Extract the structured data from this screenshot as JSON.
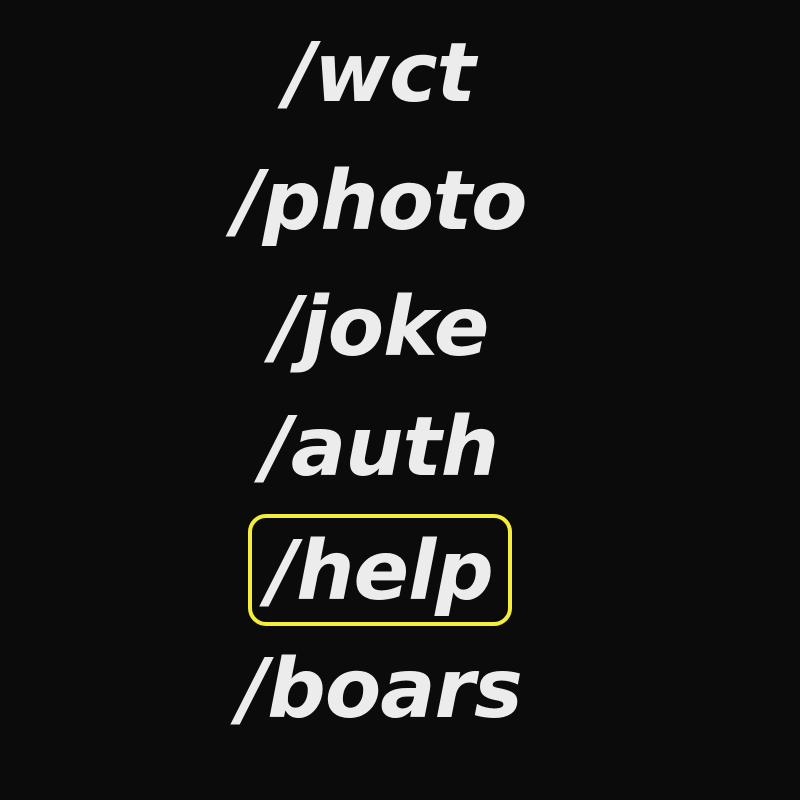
{
  "commands": [
    {
      "label": "/wct"
    },
    {
      "label": "/photo"
    },
    {
      "label": "/joke"
    },
    {
      "label": "/auth"
    },
    {
      "label": "/help"
    },
    {
      "label": "/boars"
    }
  ],
  "selected_index": 4,
  "colors": {
    "background": "#0b0b0b",
    "text": "#ececec",
    "highlight": "#f4ee3a"
  }
}
